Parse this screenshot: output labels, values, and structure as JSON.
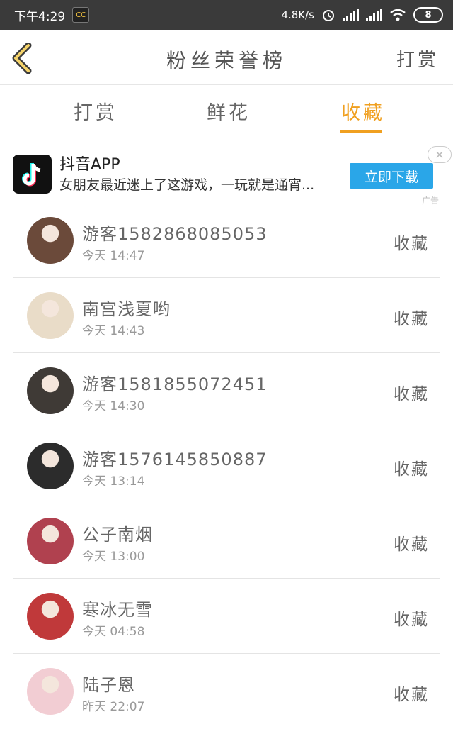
{
  "status_bar": {
    "time": "下午4:29",
    "app_badge": "CC",
    "net_speed": "4.8K/s",
    "battery": "8"
  },
  "header": {
    "title": "粉丝荣誉榜",
    "right_action": "打赏"
  },
  "tabs": [
    {
      "label": "打赏",
      "active": false
    },
    {
      "label": "鲜花",
      "active": false
    },
    {
      "label": "收藏",
      "active": true
    }
  ],
  "ad": {
    "title": "抖音APP",
    "desc": "女朋友最近迷上了这游戏，一玩就是通宵...",
    "button": "立即下载",
    "close": "✕",
    "tag": "广告"
  },
  "rows": [
    {
      "name": "游客1582868085053",
      "time": "今天 14:47",
      "action": "收藏",
      "avatar_color": "#6b4a3a"
    },
    {
      "name": "南宫浅夏哟",
      "time": "今天 14:43",
      "action": "收藏",
      "avatar_color": "#e9dcc8"
    },
    {
      "name": "游客1581855072451",
      "time": "今天 14:30",
      "action": "收藏",
      "avatar_color": "#3f3a36"
    },
    {
      "name": "游客1576145850887",
      "time": "今天 13:14",
      "action": "收藏",
      "avatar_color": "#2c2c2c"
    },
    {
      "name": "公子南烟",
      "time": "今天 13:00",
      "action": "收藏",
      "avatar_color": "#b0414f"
    },
    {
      "name": "寒冰无雪",
      "time": "今天 04:58",
      "action": "收藏",
      "avatar_color": "#c0393a"
    },
    {
      "name": "陆子恩",
      "time": "昨天 22:07",
      "action": "收藏",
      "avatar_color": "#f2cdd3"
    }
  ],
  "colors": {
    "accent": "#f0a020",
    "ad_button": "#2aa6e8",
    "status_bar": "#3a3a3a"
  }
}
